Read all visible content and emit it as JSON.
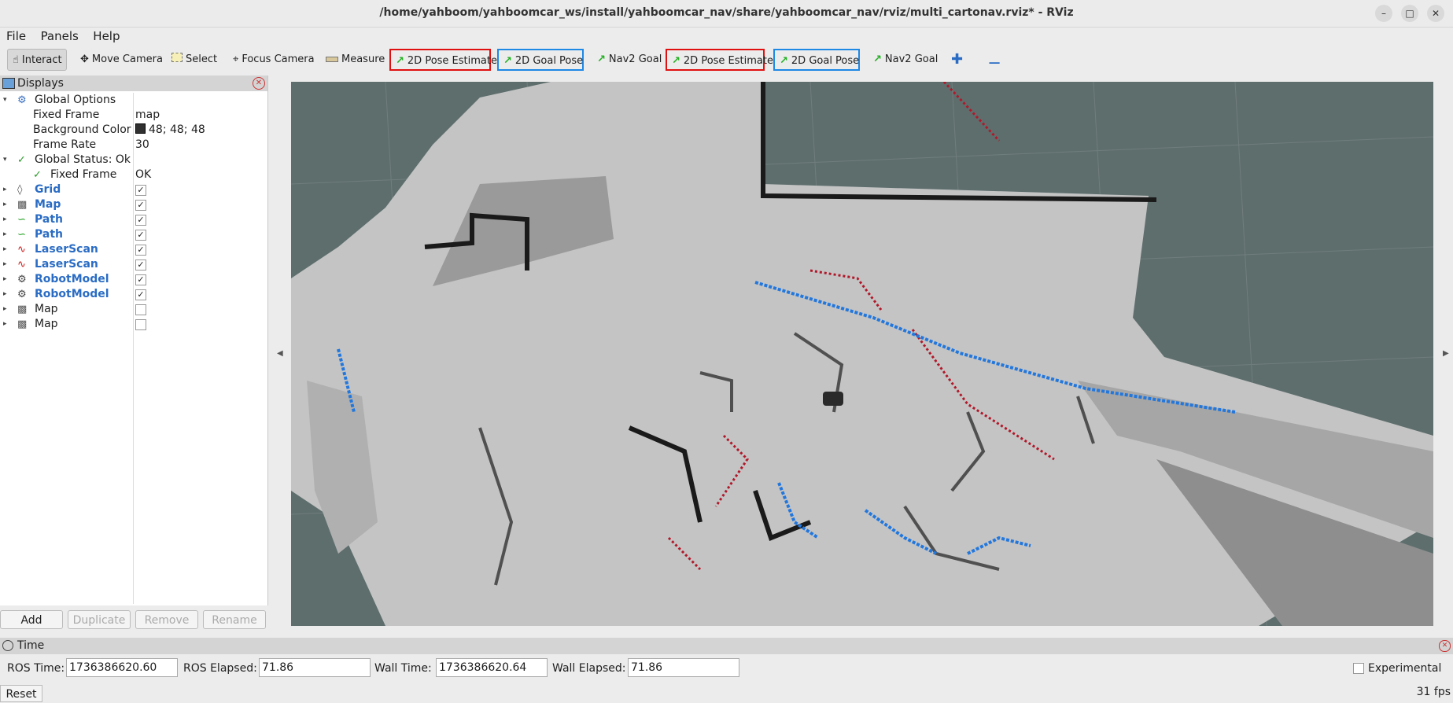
{
  "window": {
    "title": "/home/yahboom/yahboomcar_ws/install/yahboomcar_nav/share/yahboomcar_nav/rviz/multi_cartonav.rviz* - RViz"
  },
  "menu": [
    "File",
    "Panels",
    "Help"
  ],
  "toolbar": {
    "interact": "Interact",
    "move_camera": "Move Camera",
    "select": "Select",
    "focus_camera": "Focus Camera",
    "measure": "Measure",
    "pose_estimate_1": "2D Pose Estimate",
    "goal_pose_1": "2D Goal Pose",
    "nav2_goal_1": "Nav2 Goal",
    "pose_estimate_2": "2D Pose Estimate",
    "goal_pose_2": "2D Goal Pose",
    "nav2_goal_2": "Nav2 Goal"
  },
  "displays": {
    "title": "Displays",
    "global_options": "Global Options",
    "fixed_frame_label": "Fixed Frame",
    "fixed_frame_value": "map",
    "bg_color_label": "Background Color",
    "bg_color_value": "48; 48; 48",
    "frame_rate_label": "Frame Rate",
    "frame_rate_value": "30",
    "global_status": "Global Status: Ok",
    "status_fixed_frame": "Fixed Frame",
    "status_fixed_frame_value": "OK",
    "items": [
      {
        "name": "Grid",
        "checked": true
      },
      {
        "name": "Map",
        "checked": true
      },
      {
        "name": "Path",
        "checked": true
      },
      {
        "name": "Path",
        "checked": true
      },
      {
        "name": "LaserScan",
        "checked": true
      },
      {
        "name": "LaserScan",
        "checked": true
      },
      {
        "name": "RobotModel",
        "checked": true
      },
      {
        "name": "RobotModel",
        "checked": true
      },
      {
        "name": "Map",
        "checked": false
      },
      {
        "name": "Map",
        "checked": false
      }
    ],
    "buttons": {
      "add": "Add",
      "duplicate": "Duplicate",
      "remove": "Remove",
      "rename": "Rename"
    }
  },
  "time": {
    "title": "Time",
    "ros_time_label": "ROS Time:",
    "ros_time": "1736386620.60",
    "ros_elapsed_label": "ROS Elapsed:",
    "ros_elapsed": "71.86",
    "wall_time_label": "Wall Time:",
    "wall_time": "1736386620.64",
    "wall_elapsed_label": "Wall Elapsed:",
    "wall_elapsed": "71.86",
    "experimental": "Experimental",
    "reset": "Reset",
    "fps": "31 fps"
  },
  "colors": {
    "viewport_bg": "#5e6e6d",
    "laser_red": "#b0182a",
    "laser_blue": "#2277dd",
    "pose_red_border": "#e01010",
    "goal_blue_border": "#1e88e5"
  }
}
